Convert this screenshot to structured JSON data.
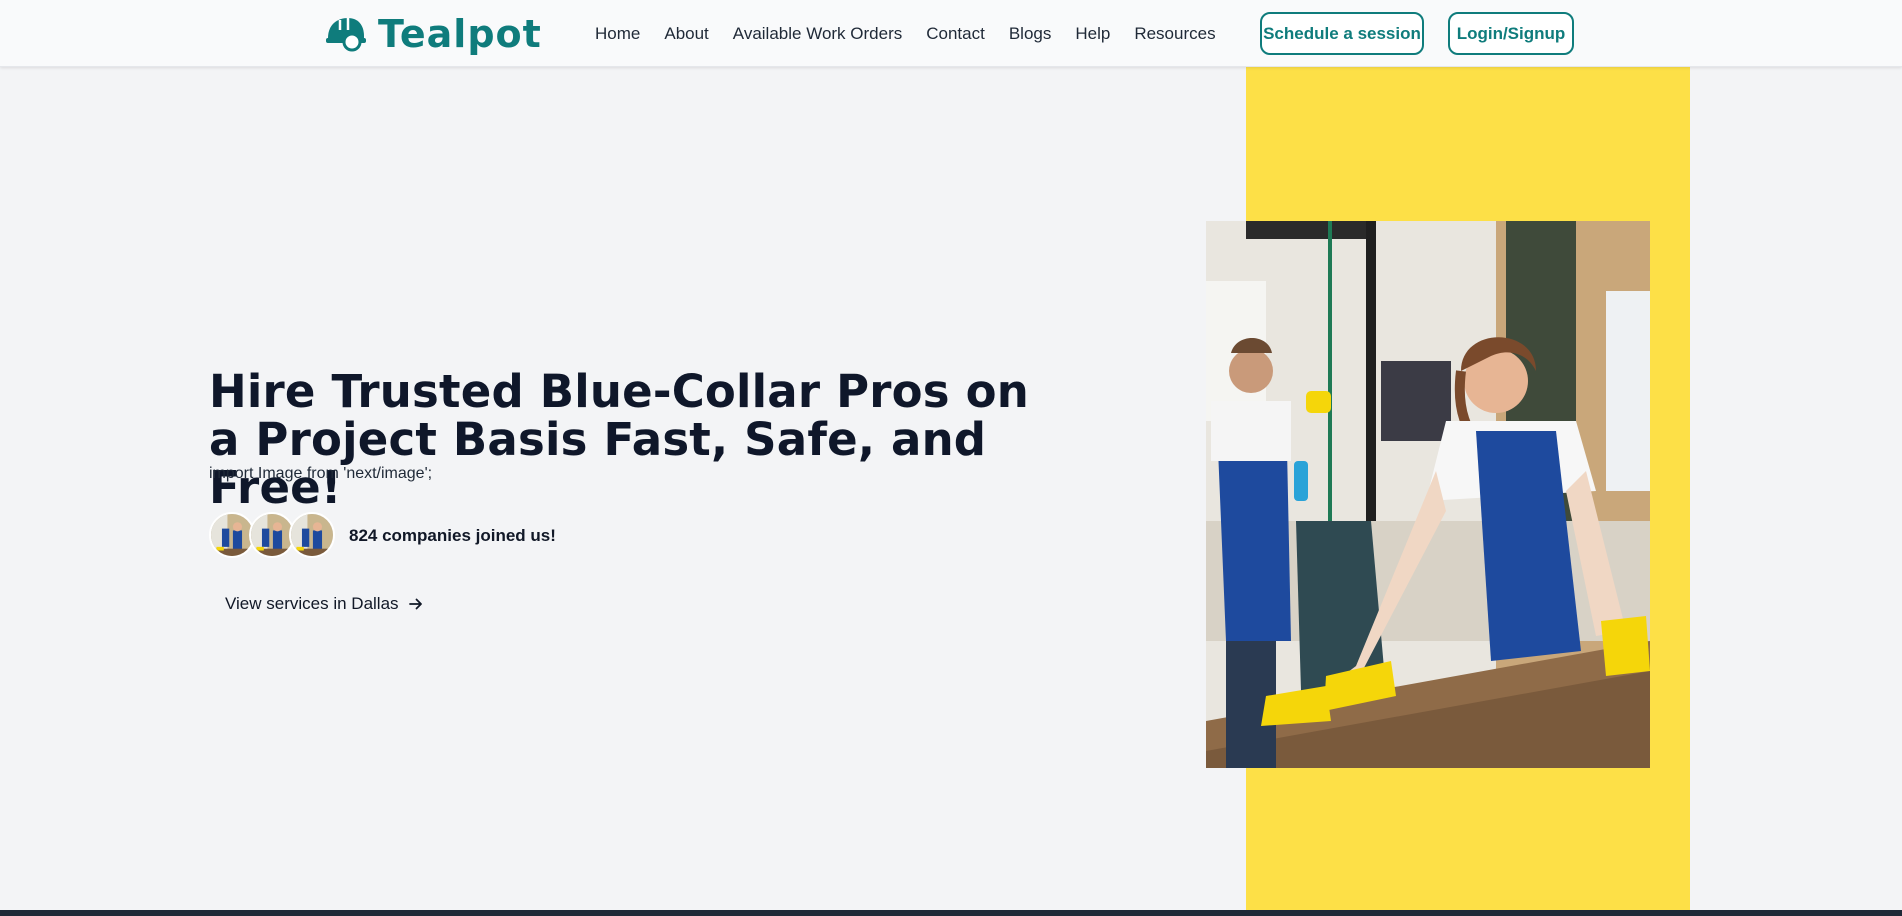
{
  "brand": {
    "name": "Tealpot",
    "color": "#0f7c7c"
  },
  "nav": {
    "items": [
      {
        "label": "Home"
      },
      {
        "label": "About"
      },
      {
        "label": "Available Work Orders"
      },
      {
        "label": "Contact"
      },
      {
        "label": "Blogs"
      },
      {
        "label": "Help"
      },
      {
        "label": "Resources"
      }
    ]
  },
  "header": {
    "schedule_label": "Schedule a session",
    "login_label": "Login/Signup"
  },
  "hero": {
    "title": "Hire Trusted Blue-Collar Pros on a Project Basis Fast, Safe, and Free!",
    "import_text": "import Image from 'next/image';",
    "companies_text": "824 companies joined us!",
    "view_services_label": "View services in Dallas",
    "arrow_icon": "arrow-right-icon",
    "accent_color": "#fde047"
  }
}
